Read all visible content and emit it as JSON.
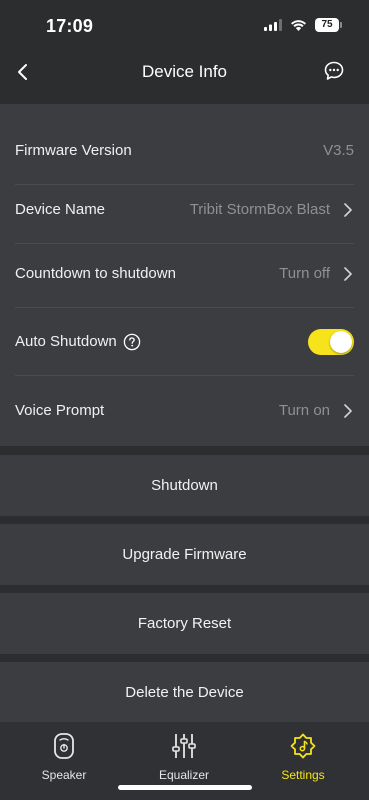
{
  "status_bar": {
    "time": "17:09",
    "battery": "75"
  },
  "header": {
    "title": "Device Info",
    "back_icon": "chevron-left-icon",
    "chat_icon": "chat-bubble-icon"
  },
  "settings": {
    "firmware": {
      "label": "Firmware Version",
      "value": "V3.5"
    },
    "device_name": {
      "label": "Device Name",
      "value": "Tribit StormBox Blast"
    },
    "countdown": {
      "label": "Countdown to shutdown",
      "value": "Turn off"
    },
    "auto_shutdown": {
      "label": "Auto Shutdown",
      "enabled": true
    },
    "voice_prompt": {
      "label": "Voice Prompt",
      "value": "Turn on"
    }
  },
  "actions": {
    "shutdown": "Shutdown",
    "upgrade": "Upgrade Firmware",
    "reset": "Factory Reset",
    "delete": "Delete the Device"
  },
  "tabs": [
    {
      "label": "Speaker",
      "icon": "speaker-icon",
      "active": false
    },
    {
      "label": "Equalizer",
      "icon": "equalizer-icon",
      "active": false
    },
    {
      "label": "Settings",
      "icon": "settings-gear-icon",
      "active": true
    }
  ],
  "colors": {
    "accent": "#f6e31b",
    "background": "#2b2d2f",
    "card": "#3b3d40",
    "muted_text": "#8e9094"
  }
}
